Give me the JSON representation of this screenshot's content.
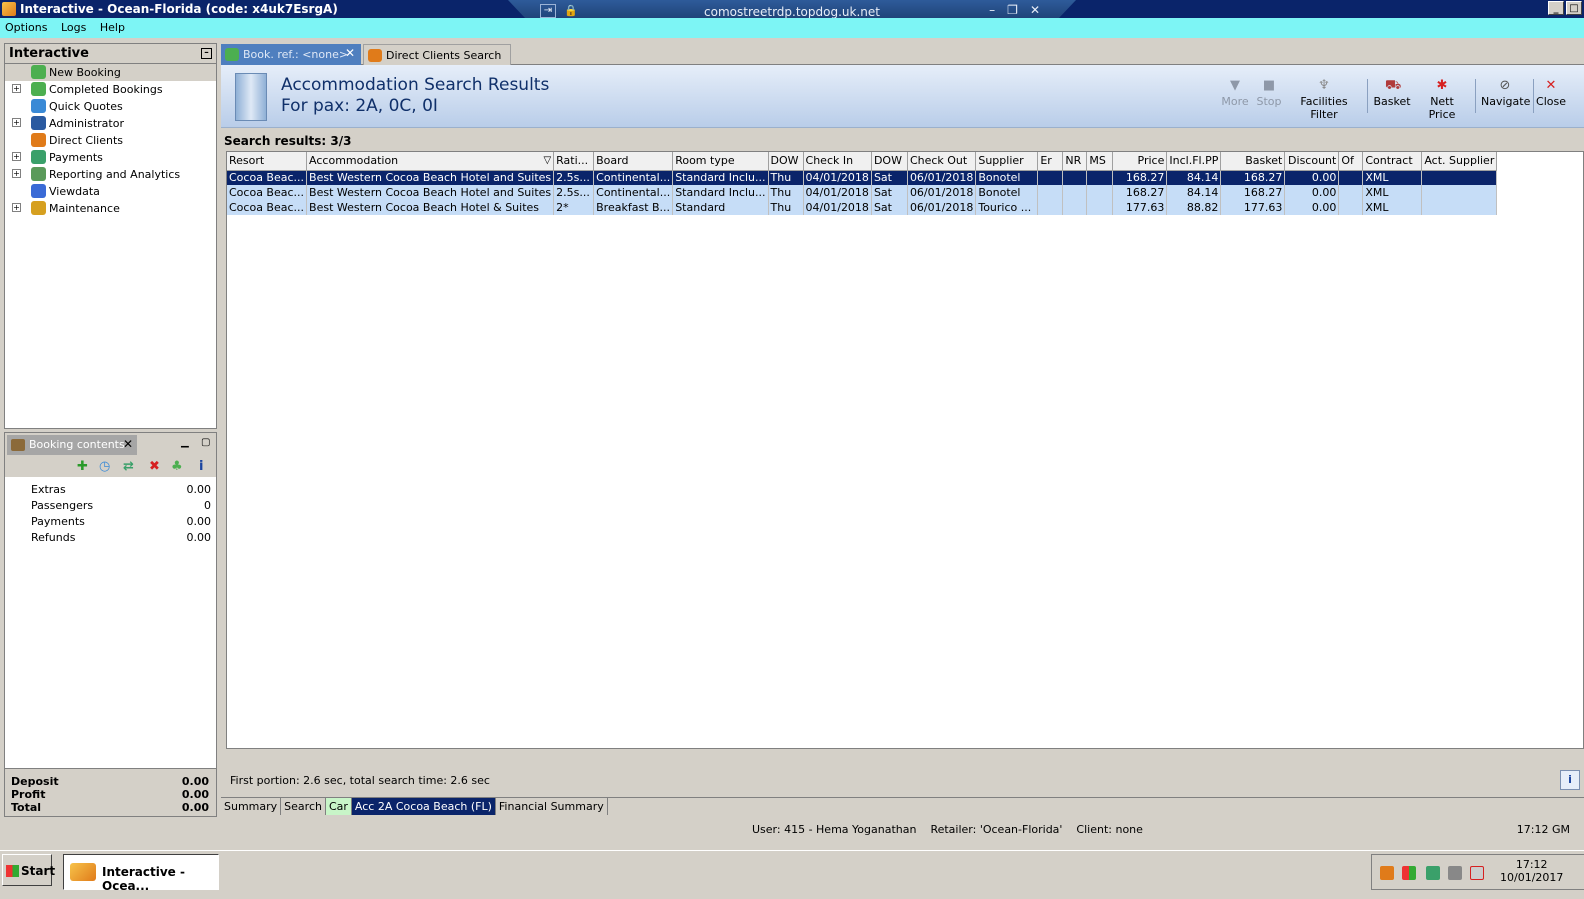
{
  "window": {
    "title": "Interactive - Ocean-Florida (code: x4uk7EsrgA)"
  },
  "rdp": {
    "host": "comostreetrdp.topdog.uk.net"
  },
  "menu": [
    "Options",
    "Logs",
    "Help"
  ],
  "nav": {
    "title": "Interactive",
    "items": [
      {
        "label": "New Booking",
        "icon": "palm-tree-icon",
        "expand": false,
        "color": "#4caf50"
      },
      {
        "label": "Completed Bookings",
        "icon": "palm-tree-icon",
        "expand": true,
        "color": "#4caf50"
      },
      {
        "label": "Quick Quotes",
        "icon": "clock-icon",
        "expand": false,
        "color": "#3a8ad6"
      },
      {
        "label": "Administrator",
        "icon": "person-icon",
        "expand": true,
        "color": "#2a5aa0"
      },
      {
        "label": "Direct Clients",
        "icon": "house-icon",
        "expand": false,
        "color": "#e07b1a"
      },
      {
        "label": "Payments",
        "icon": "cash-icon",
        "expand": true,
        "color": "#3aa06a"
      },
      {
        "label": "Reporting and Analytics",
        "icon": "report-icon",
        "expand": true,
        "color": "#5a9a5a"
      },
      {
        "label": "Viewdata",
        "icon": "globe-icon",
        "expand": false,
        "color": "#3a6ad6"
      },
      {
        "label": "Maintenance",
        "icon": "books-icon",
        "expand": true,
        "color": "#d6a020"
      }
    ]
  },
  "booking": {
    "tab_label": "Booking contents",
    "rows": [
      {
        "label": "Extras",
        "value": "0.00"
      },
      {
        "label": "Passengers",
        "value": "0"
      },
      {
        "label": "Payments",
        "value": "0.00"
      },
      {
        "label": "Refunds",
        "value": "0.00"
      }
    ],
    "totals": [
      {
        "label": "Deposit",
        "value": "0.00"
      },
      {
        "label": "Profit",
        "value": "0.00"
      },
      {
        "label": "Total",
        "value": "0.00"
      }
    ]
  },
  "tabs": [
    {
      "label": "Book. ref.: <none>",
      "active": true
    },
    {
      "label": "Direct Clients Search",
      "active": false
    }
  ],
  "header": {
    "title": "Accommodation Search Results",
    "subtitle": "For pax: 2A, 0C, 0I",
    "buttons": [
      {
        "label": "More",
        "icon": "down-arrow-icon",
        "enabled": false
      },
      {
        "label": "Stop",
        "icon": "stop-icon",
        "enabled": false
      },
      {
        "label": "Facilities Filter",
        "icon": "filter-icon",
        "enabled": true
      },
      {
        "label": "Basket",
        "icon": "basket-icon",
        "enabled": true
      },
      {
        "label": "Nett Price",
        "icon": "price-icon",
        "enabled": true
      },
      {
        "label": "Navigate",
        "icon": "navigate-icon",
        "enabled": true
      },
      {
        "label": "Close",
        "icon": "close-icon",
        "enabled": true
      }
    ]
  },
  "results": {
    "label": "Search results: 3/3",
    "columns": [
      "Resort",
      "Accommodation",
      "Rati...",
      "Board",
      "Room type",
      "DOW",
      "Check In",
      "DOW",
      "Check Out",
      "Supplier",
      "Er",
      "NR",
      "MS",
      "Price",
      "Incl.Fl.PP",
      "Basket",
      "Discount",
      "Of",
      "Contract",
      "Act. Supplier"
    ],
    "rows": [
      [
        "Cocoa Beac...",
        "Best Western Cocoa Beach Hotel and Suites",
        "2.5s...",
        "Continental...",
        "Standard Inclu...",
        "Thu",
        "04/01/2018",
        "Sat",
        "06/01/2018",
        "Bonotel",
        "",
        "",
        "",
        "168.27",
        "84.14",
        "168.27",
        "0.00",
        "",
        "XML",
        ""
      ],
      [
        "Cocoa Beac...",
        "Best Western Cocoa Beach Hotel and Suites",
        "2.5s...",
        "Continental...",
        "Standard Inclu...",
        "Thu",
        "04/01/2018",
        "Sat",
        "06/01/2018",
        "Bonotel",
        "",
        "",
        "",
        "168.27",
        "84.14",
        "168.27",
        "0.00",
        "",
        "XML",
        ""
      ],
      [
        "Cocoa Beac...",
        "Best Western Cocoa Beach Hotel & Suites",
        "2*",
        "Breakfast B...",
        "Standard",
        "Thu",
        "04/01/2018",
        "Sat",
        "06/01/2018",
        "Tourico ...",
        "",
        "",
        "",
        "177.63",
        "88.82",
        "177.63",
        "0.00",
        "",
        "XML",
        ""
      ]
    ]
  },
  "status": {
    "timing": "First portion: 2.6 sec, total search time: 2.6 sec"
  },
  "bottom_tabs": [
    "Summary",
    "Search",
    "Car",
    "Acc 2A Cocoa Beach (FL)",
    "Financial Summary"
  ],
  "userline": {
    "info": "User: 415 - Hema Yoganathan    Retailer: 'Ocean-Florida'    Client: none",
    "time": "17:12 GM"
  },
  "taskbar": {
    "start": "Start",
    "app": "Interactive - Ocea...",
    "clock_time": "17:12",
    "clock_date": "10/01/2017"
  }
}
